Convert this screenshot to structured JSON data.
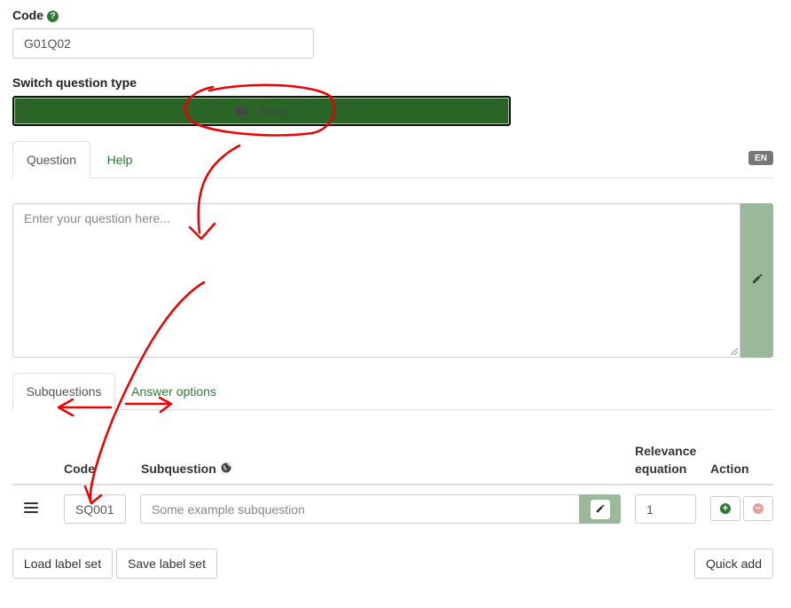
{
  "code_field": {
    "label": "Code",
    "help_icon": "question-circle-icon",
    "value": "G01Q02"
  },
  "question_type": {
    "label": "Switch question type",
    "icon": "folder-open-icon",
    "button_label": "Array"
  },
  "main_tabs": {
    "question_label": "Question",
    "help_label": "Help",
    "language_badge": "EN"
  },
  "question_editor": {
    "placeholder": "Enter your question here...",
    "edit_icon": "pencil-icon"
  },
  "sub_tabs": {
    "subquestions_label": "Subquestions",
    "answer_options_label": "Answer options"
  },
  "subquestion_table": {
    "headers": {
      "code": "Code",
      "subquestion": "Subquestion",
      "subquestion_icon": "globe-icon",
      "relevance_line1": "Relevance",
      "relevance_line2": "equation",
      "action": "Action"
    },
    "rows": [
      {
        "drag_icon": "hamburger-icon",
        "code": "SQ001",
        "subquestion_placeholder": "Some example subquestion",
        "relevance": "1",
        "add_icon": "plus-circle-icon",
        "remove_icon": "minus-circle-icon"
      }
    ]
  },
  "footer_buttons": {
    "load_label_set": "Load label set",
    "save_label_set": "Save label set",
    "quick_add": "Quick add"
  },
  "colors": {
    "accent_green": "#2c7a34",
    "type_button_bg": "#2a6427",
    "edit_panel_bg": "#9ab89a",
    "annotation_red": "#ee0000"
  }
}
